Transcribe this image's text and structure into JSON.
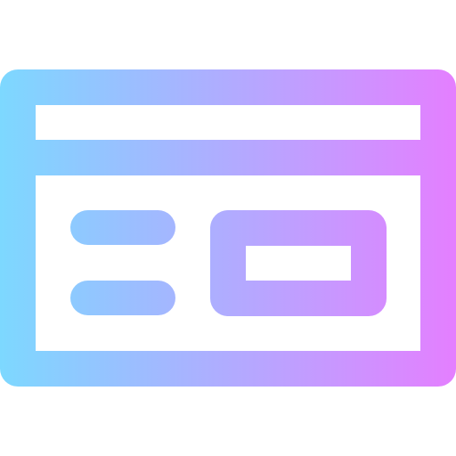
{
  "icon": {
    "name": "credit-card-icon",
    "gradient": {
      "start_color": "#7DD8FF",
      "end_color": "#E47FFF"
    }
  }
}
